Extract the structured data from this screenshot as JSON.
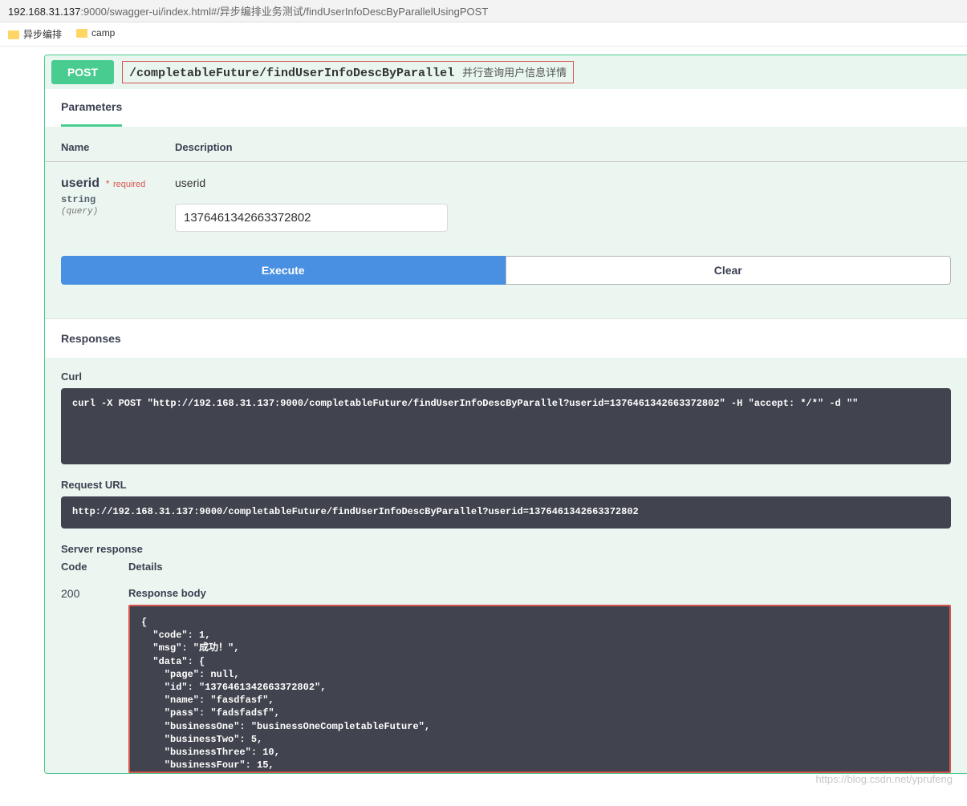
{
  "browser": {
    "url_dark": "192.168.31.137",
    "url_light": ":9000/swagger-ui/index.html#/异步编排业务测试/findUserInfoDescByParallelUsingPOST",
    "bookmarks": [
      "异步编排",
      "camp"
    ]
  },
  "operation": {
    "method": "POST",
    "path": "/completableFuture/findUserInfoDescByParallel",
    "summary": "并行查询用户信息详情"
  },
  "tabs": {
    "parameters": "Parameters"
  },
  "params": {
    "header_name": "Name",
    "header_desc": "Description",
    "name": "userid",
    "required_label": "required",
    "type": "string",
    "in": "(query)",
    "desc": "userid",
    "value": "1376461342663372802"
  },
  "buttons": {
    "execute": "Execute",
    "clear": "Clear"
  },
  "responses": {
    "title": "Responses",
    "curl_label": "Curl",
    "curl_cmd": "curl -X POST \"http://192.168.31.137:9000/completableFuture/findUserInfoDescByParallel?userid=1376461342663372802\" -H \"accept: */*\" -d \"\"",
    "url_label": "Request URL",
    "url_value": "http://192.168.31.137:9000/completableFuture/findUserInfoDescByParallel?userid=1376461342663372802",
    "server_label": "Server response",
    "code_label": "Code",
    "details_label": "Details",
    "code_value": "200",
    "body_label": "Response body",
    "body_value": "{\n  \"code\": 1,\n  \"msg\": \"成功！\",\n  \"data\": {\n    \"page\": null,\n    \"id\": \"1376461342663372802\",\n    \"name\": \"fasdfasf\",\n    \"pass\": \"fadsfadsf\",\n    \"businessOne\": \"businessOneCompletableFuture\",\n    \"businessTwo\": 5,\n    \"businessThree\": 10,\n    \"businessFour\": 15,"
  },
  "watermark": "https://blog.csdn.net/yprufeng"
}
